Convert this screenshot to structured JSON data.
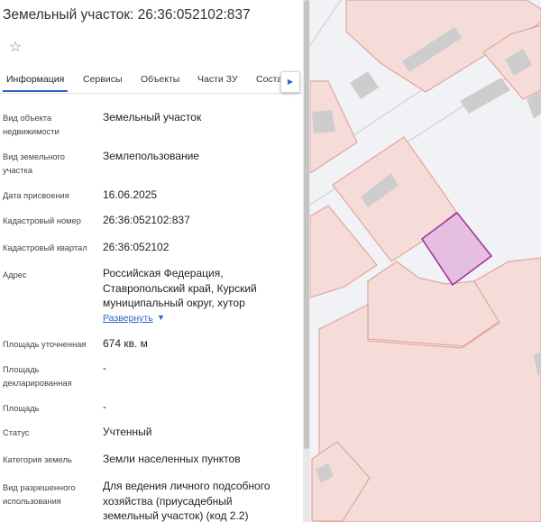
{
  "header": {
    "title": "Земельный участок: 26:36:052102:837"
  },
  "tabs": [
    {
      "label": "Информация",
      "active": true
    },
    {
      "label": "Сервисы"
    },
    {
      "label": "Объекты"
    },
    {
      "label": "Части ЗУ"
    },
    {
      "label": "Соста"
    }
  ],
  "fields": [
    {
      "label": "Вид объекта недвижимости",
      "value": "Земельный участок"
    },
    {
      "label": "Вид земельного участка",
      "value": "Землепользование"
    },
    {
      "label": "Дата присвоения",
      "value": "16.06.2025"
    },
    {
      "label": "Кадастровый номер",
      "value": "26:36:052102:837"
    },
    {
      "label": "Кадастровый квартал",
      "value": "26:36:052102"
    },
    {
      "label": "Адрес",
      "value": "Российская Федерация, Ставропольский край, Курский муниципальный округ, хутор"
    },
    {
      "label": "Площадь уточненная",
      "value": "674 кв. м"
    },
    {
      "label": "Площадь декларированная",
      "value": "-"
    },
    {
      "label": "Площадь",
      "value": "-"
    },
    {
      "label": "Статус",
      "value": "Учтенный"
    },
    {
      "label": "Категория земель",
      "value": "Земли населенных пунктов"
    },
    {
      "label": "Вид разрешенного использования",
      "value": "Для ведения личного подсобного хозяйства (приусадебный земельный участок) (код 2.2)"
    }
  ],
  "address_expand_label": "Развернуть",
  "icons": {
    "favorite": "star-outline-icon",
    "tabs_scroll": "chevron-right-icon",
    "expand": "chevron-down-icon"
  },
  "colors": {
    "accent": "#2f62c9",
    "parcel_fill": "#f6dcd8",
    "parcel_stroke": "#e1a59c",
    "selected_parcel_fill": "#e6bfe0",
    "selected_parcel_stroke": "#a2379a",
    "building_fill": "#cdcdcd"
  }
}
